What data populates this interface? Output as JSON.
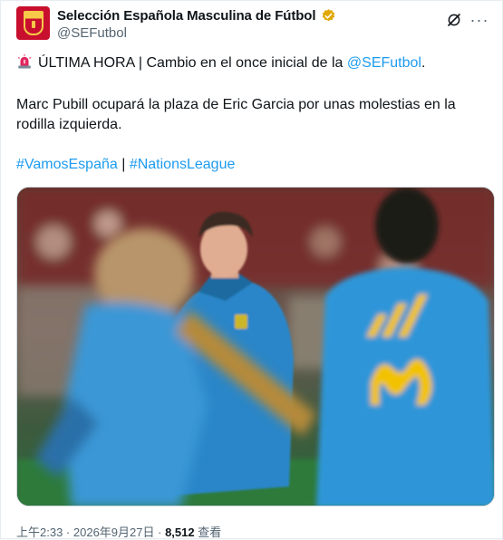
{
  "account": {
    "display_name": "Selección Española Masculina de Fútbol",
    "handle": "@SEFutbol",
    "verified_color": "#e0a800",
    "avatar_icon": "spain-crest-icon"
  },
  "header_actions": {
    "grok_icon": "grok-icon",
    "more_icon": "more-options-icon",
    "more_label": "···"
  },
  "tweet": {
    "line1_icon": "siren-icon",
    "line1_prefix": "ÚLTIMA HORA | Cambio en el once inicial de la ",
    "line1_mention": "@SEFutbol",
    "line1_suffix": ".",
    "line2": "Marc Pubill ocupará la plaza de Eric Garcia por unas molestias en la rodilla izquierda.",
    "hashtag1": "#VamosEspaña",
    "separator": " | ",
    "hashtag2": "#NationsLeague"
  },
  "media": {
    "description_icon": "photo-icon",
    "accent_colors": {
      "shirt": "#2f8fd0",
      "sponsor": "#f2c200",
      "background": "#3a4a3a"
    }
  },
  "meta": {
    "time": "上午2:33",
    "dot1": " · ",
    "date": "2026年9月27日",
    "dot2": " · ",
    "views": "8,512",
    "views_label": " 查看"
  },
  "colors": {
    "link": "#1d9bf0",
    "secondary_text": "#536471"
  }
}
